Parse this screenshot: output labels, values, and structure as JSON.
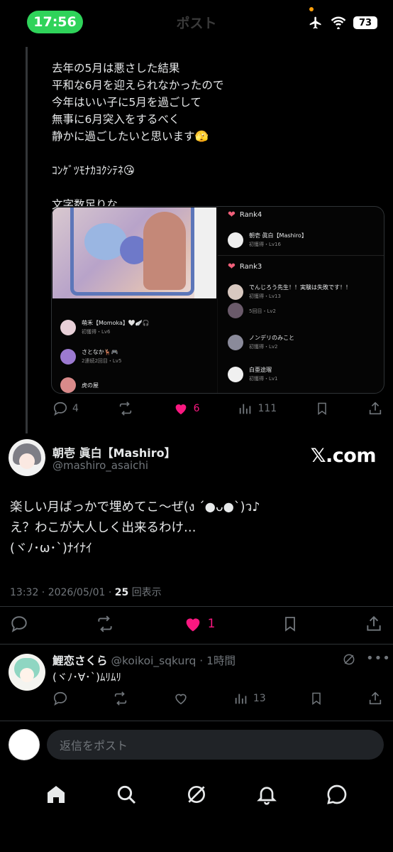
{
  "status_bar": {
    "time": "17:56",
    "battery": "73"
  },
  "header": {
    "title": "ポスト"
  },
  "quoted_post": {
    "text": "去年の5月は悪さした結果\n平和な6月を迎えられなかったので\n今年はいい子に5月を過ごして\n無事に6月突入をするべく\n静かに過ごしたいと思います🫣\n\nｺﾝｹﾞﾂﾓﾅｶﾖｸｼﾃﾈ😘\n\n文字数足りな",
    "ranking": {
      "rank4_label": "Rank4",
      "rank3_label": "Rank3",
      "entries_right": [
        {
          "name": "朝壱 眞白【Mashiro】",
          "sub": "初獲得・Lv16"
        },
        {
          "name": "でんじろう先生！！実験は失敗です！！",
          "sub": "初獲得・Lv13"
        },
        {
          "name": "",
          "sub": "5回目・Lv2"
        },
        {
          "name": "ノンデリのみこと",
          "sub": "初獲得・Lv2"
        },
        {
          "name": "白亜途瑠",
          "sub": "初獲得・Lv1"
        }
      ],
      "entries_left": [
        {
          "name": "萌禾【Momoka】🤍🪽🎧",
          "sub": "初獲得・Lv6"
        },
        {
          "name": "さとなか🦌🎮",
          "sub": "2連続2回目・Lv5"
        },
        {
          "name": "虎の屋",
          "sub": ""
        }
      ]
    },
    "actions": {
      "replies": "4",
      "likes": "6",
      "views": "111"
    }
  },
  "main_post": {
    "author_name": "朝壱 眞白【Mashiro】",
    "author_handle": "@mashiro_asaichi",
    "brand": "𝕏.com",
    "text": "楽しい月ばっかで埋めてこ〜ぜ(ง ˊ●ᴗ●ˋ)ว♪\nえ？わこが大人しく出来るわけ…\n(ヾﾉ･ω･`)ﾅｲﾅｲ",
    "time": "13:32 · 2026/05/01 · ",
    "views_count": "25",
    "views_label": "回表示",
    "likes": "1"
  },
  "reply": {
    "name": "鯉恋さくら",
    "handle_time": "@koikoi_sqkurq · 1時間",
    "text": "(ヾﾉ･∀･`)ﾑﾘﾑﾘ",
    "views": "13"
  },
  "compose": {
    "placeholder": "返信をポスト"
  },
  "colors": {
    "like": "#f91880",
    "muted": "#71767b",
    "accent_status": "#2fd35a"
  }
}
